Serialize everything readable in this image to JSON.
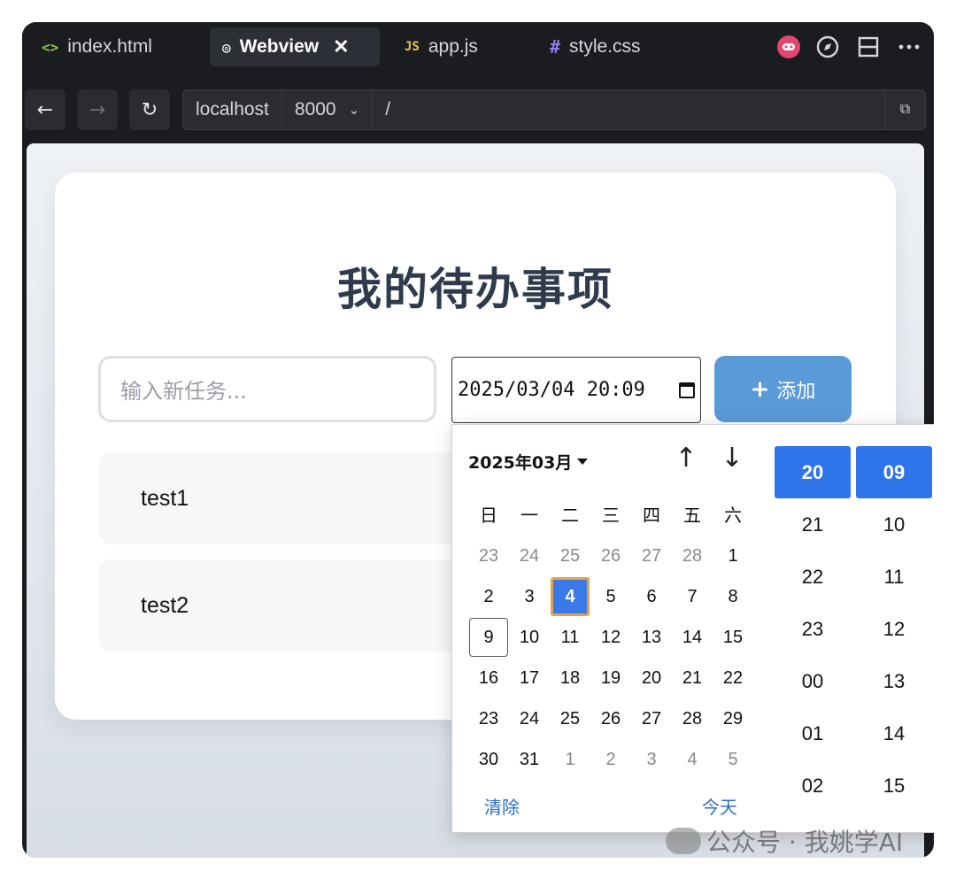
{
  "tabs": [
    {
      "icon": "<>",
      "label": "index.html"
    },
    {
      "icon": "◎",
      "label": "Webview",
      "close": "✕"
    },
    {
      "icon": "JS",
      "label": "app.js"
    },
    {
      "icon": "#",
      "label": "style.css"
    }
  ],
  "icons": {
    "tab_html": "code-icon",
    "tab_webview": "webview-icon",
    "tab_js": "js-icon",
    "tab_css": "hash-icon"
  },
  "colors": {
    "html_icon": "#8bc34a",
    "js_icon": "#e6c84a",
    "css_icon": "#8f7cf0",
    "accent_blue": "#2f74e8",
    "add_button": "#5b9ad8"
  },
  "nav": {
    "back": "←",
    "forward": "→",
    "reload": "↻"
  },
  "url": {
    "host": "localhost",
    "port": "8000",
    "path": "/"
  },
  "page": {
    "title": "我的待办事项",
    "task_placeholder": "输入新任务...",
    "datetime_value": "2025/03/04 20:09",
    "add_label": "添加",
    "add_icon": "+",
    "tasks": [
      "test1",
      "test2"
    ]
  },
  "picker": {
    "month_label": "2025年03月",
    "weekdays": [
      "日",
      "一",
      "二",
      "三",
      "四",
      "五",
      "六"
    ],
    "days": [
      [
        "23",
        "24",
        "25",
        "26",
        "27",
        "28",
        "1"
      ],
      [
        "2",
        "3",
        "4",
        "5",
        "6",
        "7",
        "8"
      ],
      [
        "9",
        "10",
        "11",
        "12",
        "13",
        "14",
        "15"
      ],
      [
        "16",
        "17",
        "18",
        "19",
        "20",
        "21",
        "22"
      ],
      [
        "23",
        "24",
        "25",
        "26",
        "27",
        "28",
        "29"
      ],
      [
        "30",
        "31",
        "1",
        "2",
        "3",
        "4",
        "5"
      ]
    ],
    "selected_day": "4",
    "clear_label": "清除",
    "today_label": "今天",
    "hours": [
      "20",
      "21",
      "22",
      "23",
      "00",
      "01",
      "02"
    ],
    "minutes": [
      "09",
      "10",
      "11",
      "12",
      "13",
      "14",
      "15"
    ]
  },
  "watermark": "公众号 · 我姚学AI"
}
